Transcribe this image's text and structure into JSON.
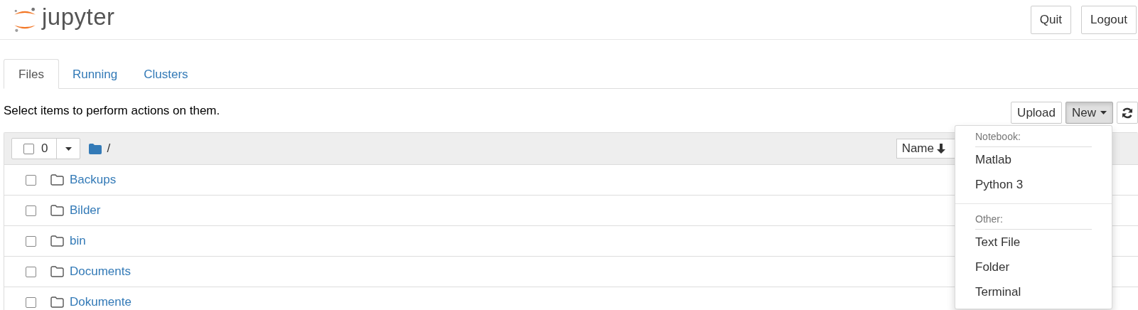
{
  "header": {
    "logo_text": "jupyter",
    "buttons": [
      "Quit",
      "Logout"
    ]
  },
  "tabs": [
    {
      "label": "Files",
      "selected": true
    },
    {
      "label": "Running",
      "selected": false
    },
    {
      "label": "Clusters",
      "selected": false
    }
  ],
  "toolbar": {
    "hint": "Select items to perform actions on them.",
    "upload": "Upload",
    "new": "New"
  },
  "file_list": {
    "select_all_checked": false,
    "selected_count": "0",
    "path": "/",
    "sort_button": "Name",
    "rows": [
      {
        "name": "Backups",
        "checked": false
      },
      {
        "name": "Bilder",
        "checked": false
      },
      {
        "name": "bin",
        "checked": false
      },
      {
        "name": "Documents",
        "checked": false
      },
      {
        "name": "Dokumente",
        "checked": false
      }
    ]
  },
  "new_menu": {
    "sections": [
      {
        "header": "Notebook:",
        "items": [
          "Matlab",
          "Python 3"
        ]
      },
      {
        "header": "Other:",
        "items": [
          "Text File",
          "Folder",
          "Terminal"
        ]
      }
    ]
  }
}
